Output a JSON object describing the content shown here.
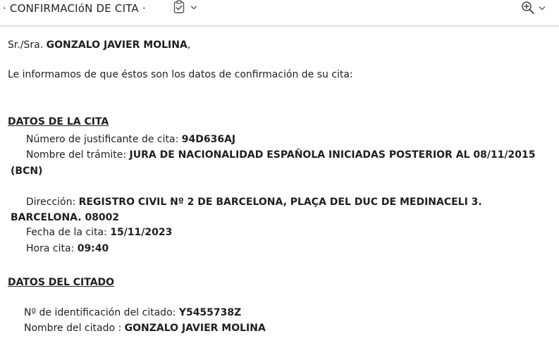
{
  "toolbar": {
    "subject": "· CONFIRMACIóN DE CITA ·",
    "tag_icon": "clipboard-check-icon",
    "tag_dropdown_icon": "chevron-down-icon",
    "zoom_icon": "zoom-in-icon",
    "zoom_dropdown_icon": "chevron-down-icon"
  },
  "email": {
    "salutation_prefix": "Sr./Sra.",
    "salutation_name": "GONZALO JAVIER MOLINA",
    "salutation_suffix": ",",
    "intro": "Le informamos de que éstos son los datos de confirmación de su cita:",
    "cita": {
      "heading": "DATOS DE LA CITA",
      "justificante_label": "Número de justificante de cita:",
      "justificante_value": "94D636AJ",
      "tramite_label": "Nombre del trámite:",
      "tramite_value_line1": "JURA DE NACIONALIDAD ESPAÑOLA INICIADAS POSTERIOR AL 08/11/2015",
      "tramite_value_line2": "(BCN)",
      "direccion_label": "Dirección:",
      "direccion_value_line1": "REGISTRO CIVIL Nº 2 DE BARCELONA, PLAÇA DEL DUC DE MEDINACELI 3.",
      "direccion_value_line2": "BARCELONA. 08002",
      "fecha_label": "Fecha de la cita:",
      "fecha_value": "15/11/2023",
      "hora_label": "Hora cita:",
      "hora_value": "09:40"
    },
    "citado": {
      "heading": "DATOS DEL CITADO",
      "id_label": "Nº de identificación del citado:",
      "id_value": "Y5455738Z",
      "nombre_label": "Nombre del citado :",
      "nombre_value": "GONZALO JAVIER MOLINA"
    }
  }
}
